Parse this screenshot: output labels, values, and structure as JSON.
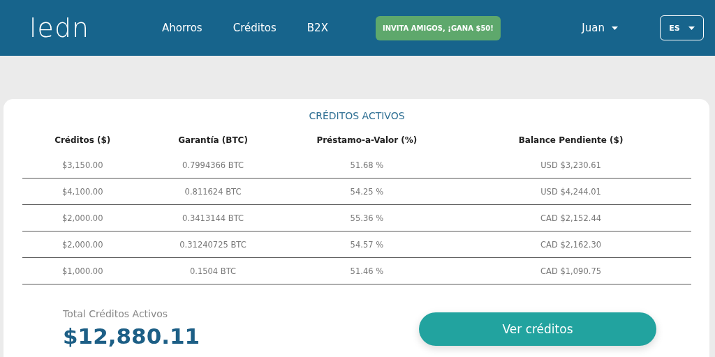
{
  "header": {
    "logo": "ledn",
    "nav": [
      {
        "label": "Ahorros"
      },
      {
        "label": "Créditos"
      },
      {
        "label": "B2X"
      }
    ],
    "promo": "INVITA AMIGOS, ¡GANA $50!",
    "user": "Juan",
    "language": "ES"
  },
  "loans": {
    "title": "CRÉDITOS ACTIVOS",
    "columns": [
      "Créditos ($)",
      "Garantía (BTC)",
      "Préstamo-a-Valor (%)",
      "Balance Pendiente ($)"
    ],
    "rows": [
      [
        "$3,150.00",
        "0.7994366 BTC",
        "51.68 %",
        "USD $3,230.61"
      ],
      [
        "$4,100.00",
        "0.811624 BTC",
        "54.25 %",
        "USD $4,244.01"
      ],
      [
        "$2,000.00",
        "0.3413144 BTC",
        "55.36 %",
        "CAD $2,152.44"
      ],
      [
        "$2,000.00",
        "0.31240725 BTC",
        "54.57 %",
        "CAD $2,162.30"
      ],
      [
        "$1,000.00",
        "0.1504 BTC",
        "51.46 %",
        "CAD $1,090.75"
      ]
    ],
    "total_label": "Total Créditos Activos",
    "total": "$12,880.11",
    "button": "Ver créditos"
  }
}
